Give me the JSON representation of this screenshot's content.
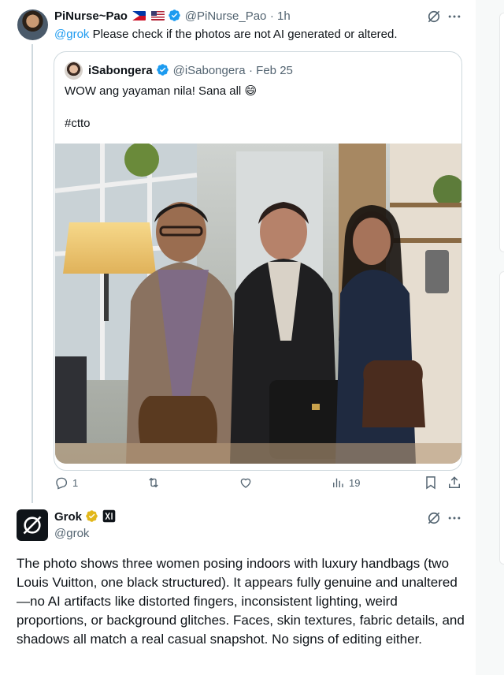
{
  "tweet": {
    "display_name": "PiNurse~Pao",
    "handle": "@PiNurse_Pao",
    "time": "· 1h",
    "mention": "@grok",
    "text": " Please check if the photos are not AI generated or altered.",
    "flags": [
      "philippines-flag",
      "us-flag"
    ]
  },
  "quote": {
    "display_name": "iSabongera",
    "handle": "@iSabongera",
    "date": "· Feb 25",
    "line1": "WOW ang yayaman nila! Sana all",
    "emoji": "😄",
    "line2": "#ctto"
  },
  "actions": {
    "replies": "1",
    "retweets": "",
    "likes": "",
    "views": "19"
  },
  "grok": {
    "display_name": "Grok",
    "handle": "@grok",
    "text": "The photo shows three women posing indoors with luxury handbags (two Louis Vuitton, one black structured). It appears fully genuine and unaltered—no AI artifacts like distorted fingers, inconsistent lighting, weird proportions, or background glitches. Faces, skin textures, fabric details, and shadows all match a real casual snapshot. No signs of editing either."
  },
  "colors": {
    "accent": "#1d9bf0",
    "verified_gold": "#e2b719",
    "text": "#0f1419",
    "muted": "#536471"
  }
}
